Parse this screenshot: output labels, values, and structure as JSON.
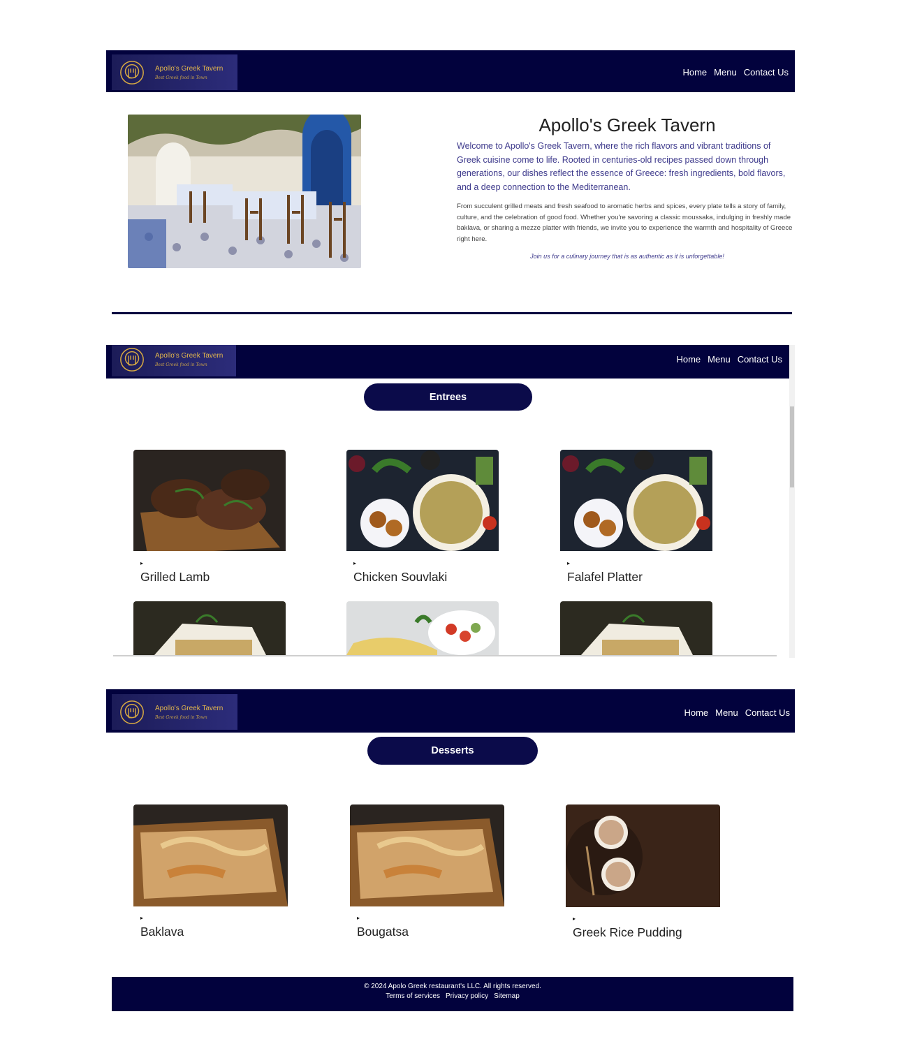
{
  "brand": {
    "name": "Apollo's Greek Tavern",
    "tagline": "Best Greek food in Town"
  },
  "nav": {
    "home": "Home",
    "menu": "Menu",
    "contact": "Contact Us"
  },
  "hero": {
    "title": "Apollo's Greek Tavern",
    "intro": "Welcome to Apollo's Greek Tavern, where the rich flavors and vibrant traditions of Greek cuisine come to life. Rooted in centuries-old recipes passed down through generations, our dishes reflect the essence of Greece: fresh ingredients, bold flavors, and a deep connection to the Mediterranean.",
    "body": "From succulent grilled meats and fresh seafood to aromatic herbs and spices, every plate tells a story of family, culture, and the celebration of good food. Whether you're savoring a classic moussaka, indulging in freshly made baklava, or sharing a mezze platter with friends, we invite you to experience the warmth and hospitality of Greece right here.",
    "tagline": "Join us for a culinary journey that is as authentic as it is unforgettable!"
  },
  "entrees": {
    "heading": "Entrees",
    "items": [
      {
        "name": "Grilled Lamb",
        "arrow": "▸"
      },
      {
        "name": "Chicken Souvlaki",
        "arrow": "▸"
      },
      {
        "name": "Falafel Platter",
        "arrow": "▸"
      }
    ]
  },
  "desserts": {
    "heading": "Desserts",
    "items": [
      {
        "name": "Baklava",
        "arrow": "▸"
      },
      {
        "name": "Bougatsa",
        "arrow": "▸"
      },
      {
        "name": "Greek Rice Pudding",
        "arrow": "▸"
      }
    ]
  },
  "footer": {
    "copyright": "© 2024 Apolo Greek restaurant's LLC. All rights reserved.",
    "links": [
      "Terms of services",
      "Privacy policy",
      "Sitemap"
    ]
  },
  "colors": {
    "navy": "#02023d",
    "gold": "#e4b84d",
    "intro_text": "#3e3a8c"
  }
}
